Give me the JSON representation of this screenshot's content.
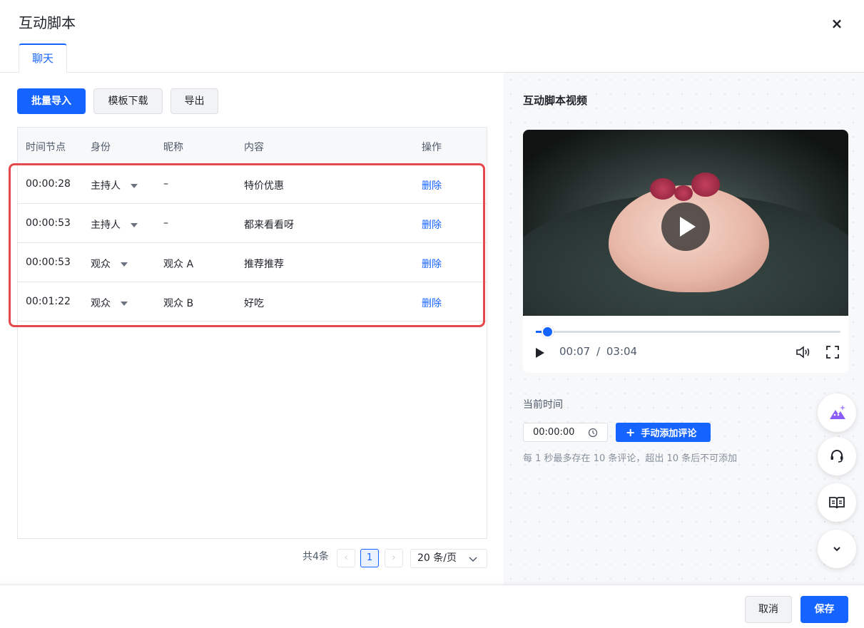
{
  "dialog": {
    "title": "互动脚本",
    "close_label": "×"
  },
  "tabs": [
    {
      "label": "聊天"
    }
  ],
  "toolbar": {
    "import_label": "批量导入",
    "template_label": "模板下载",
    "export_label": "导出"
  },
  "table": {
    "headers": [
      "时间节点",
      "身份",
      "昵称",
      "内容",
      "操作"
    ],
    "rows": [
      {
        "time": "00:00:28",
        "role": "主持人",
        "nickname": "–",
        "content": "特价优惠",
        "action": "删除"
      },
      {
        "time": "00:00:53",
        "role": "主持人",
        "nickname": "–",
        "content": "都来看看呀",
        "action": "删除"
      },
      {
        "time": "00:00:53",
        "role": "观众",
        "nickname": "观众 A",
        "content": "推荐推荐",
        "action": "删除"
      },
      {
        "time": "00:01:22",
        "role": "观众",
        "nickname": "观众 B",
        "content": "好吃",
        "action": "删除"
      }
    ]
  },
  "pagination": {
    "total": "共4条",
    "prev": "‹",
    "current": "1",
    "next": "›",
    "page_size": "20 条/页"
  },
  "video_panel": {
    "title": "互动脚本视频",
    "current_time": "00:07",
    "separator": "/",
    "duration": "03:04",
    "progress": 0.038
  },
  "comment": {
    "label": "当前时间",
    "time_value": "00:00:00",
    "add_label": "手动添加评论",
    "hint": "每 1 秒最多存在 10 条评论，超出 10 条后不可添加"
  },
  "footer": {
    "cancel_label": "取消",
    "save_label": "保存"
  },
  "colors": {
    "primary": "#1664ff",
    "highlight": "#e5484d"
  }
}
